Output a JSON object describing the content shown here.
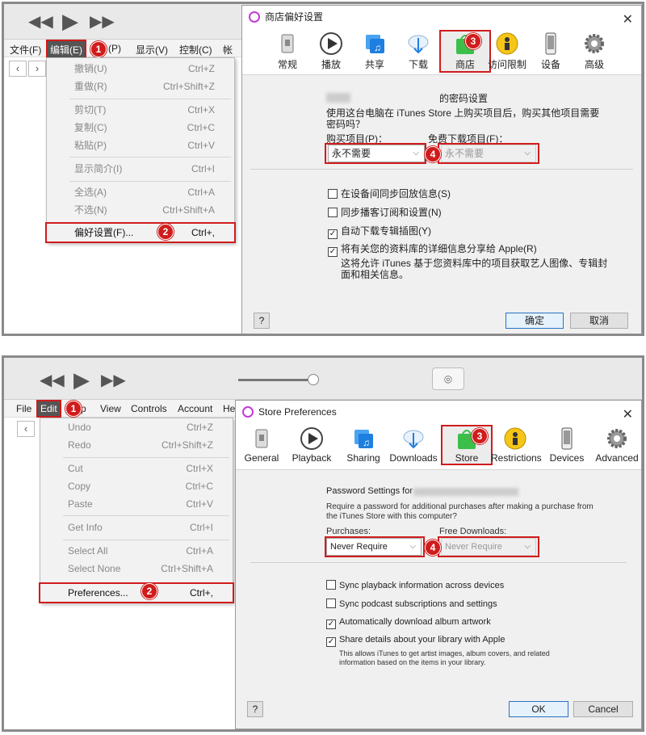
{
  "top": {
    "player": {
      "prev": "◀◀",
      "play": "▶",
      "next": "▶▶"
    },
    "menubar": [
      "文件(F)",
      "编辑(E)",
      "(P)",
      "显示(V)",
      "控制(C)",
      "帐"
    ],
    "edit_menu": [
      {
        "label": "撤销(U)",
        "shortcut": "Ctrl+Z"
      },
      {
        "label": "重做(R)",
        "shortcut": "Ctrl+Shift+Z"
      },
      {
        "label": "剪切(T)",
        "shortcut": "Ctrl+X"
      },
      {
        "label": "复制(C)",
        "shortcut": "Ctrl+C"
      },
      {
        "label": "粘贴(P)",
        "shortcut": "Ctrl+V"
      },
      {
        "label": "显示简介(I)",
        "shortcut": "Ctrl+I"
      },
      {
        "label": "全选(A)",
        "shortcut": "Ctrl+A"
      },
      {
        "label": "不选(N)",
        "shortcut": "Ctrl+Shift+A"
      },
      {
        "label": "偏好设置(F)...",
        "shortcut": "Ctrl+,"
      }
    ],
    "dialog": {
      "title": "商店偏好设置",
      "tabs": [
        "常规",
        "播放",
        "共享",
        "下载",
        "商店",
        "访问限制",
        "设备",
        "高级"
      ],
      "password_heading": "的密码设置",
      "description": "使用这台电脑在 iTunes Store 上购买项目后，购买其他项目需要密码吗？",
      "purchases_label": "购买项目(P)：",
      "purchases_value": "永不需要",
      "free_label": "免费下载项目(F)：",
      "free_value": "永不需要",
      "checkboxes": [
        {
          "label": "在设备间同步回放信息(S)",
          "checked": false
        },
        {
          "label": "同步播客订阅和设置(N)",
          "checked": false
        },
        {
          "label": "自动下载专辑插图(Y)",
          "checked": true
        },
        {
          "label": "将有关您的资料库的详细信息分享给 Apple(R)",
          "checked": true
        }
      ],
      "share_note": "这将允许 iTunes 基于您资料库中的项目获取艺人图像、专辑封面和相关信息。",
      "help": "?",
      "ok": "确定",
      "cancel": "取消"
    }
  },
  "bottom": {
    "player": {
      "prev": "◀◀",
      "play": "▶",
      "next": "▶▶"
    },
    "menubar": [
      "File",
      "Edit",
      "p",
      "View",
      "Controls",
      "Account",
      "He"
    ],
    "edit_menu": [
      {
        "label": "Undo",
        "shortcut": "Ctrl+Z"
      },
      {
        "label": "Redo",
        "shortcut": "Ctrl+Shift+Z"
      },
      {
        "label": "Cut",
        "shortcut": "Ctrl+X"
      },
      {
        "label": "Copy",
        "shortcut": "Ctrl+C"
      },
      {
        "label": "Paste",
        "shortcut": "Ctrl+V"
      },
      {
        "label": "Get Info",
        "shortcut": "Ctrl+I"
      },
      {
        "label": "Select All",
        "shortcut": "Ctrl+A"
      },
      {
        "label": "Select None",
        "shortcut": "Ctrl+Shift+A"
      },
      {
        "label": "Preferences...",
        "shortcut": "Ctrl+,"
      }
    ],
    "dialog": {
      "title": "Store Preferences",
      "tabs": [
        "General",
        "Playback",
        "Sharing",
        "Downloads",
        "Store",
        "Restrictions",
        "Devices",
        "Advanced"
      ],
      "password_heading": "Password Settings for",
      "description": "Require a password for additional purchases after making a purchase from the iTunes Store with this computer?",
      "purchases_label": "Purchases:",
      "purchases_value": "Never Require",
      "free_label": "Free Downloads:",
      "free_value": "Never Require",
      "checkboxes": [
        {
          "label": "Sync playback information across devices",
          "checked": false
        },
        {
          "label": "Sync podcast subscriptions and settings",
          "checked": false
        },
        {
          "label": "Automatically download album artwork",
          "checked": true
        },
        {
          "label": "Share details about your library with Apple",
          "checked": true
        }
      ],
      "share_note": "This allows iTunes to get artist images, album covers, and related information based on the items in your library.",
      "help": "?",
      "ok": "OK",
      "cancel": "Cancel"
    }
  },
  "badges": [
    "1",
    "2",
    "3",
    "4"
  ],
  "colors": {
    "accent": "#d01c1c",
    "badge": "#d01c1c",
    "ok_border": "#2a72c4"
  }
}
